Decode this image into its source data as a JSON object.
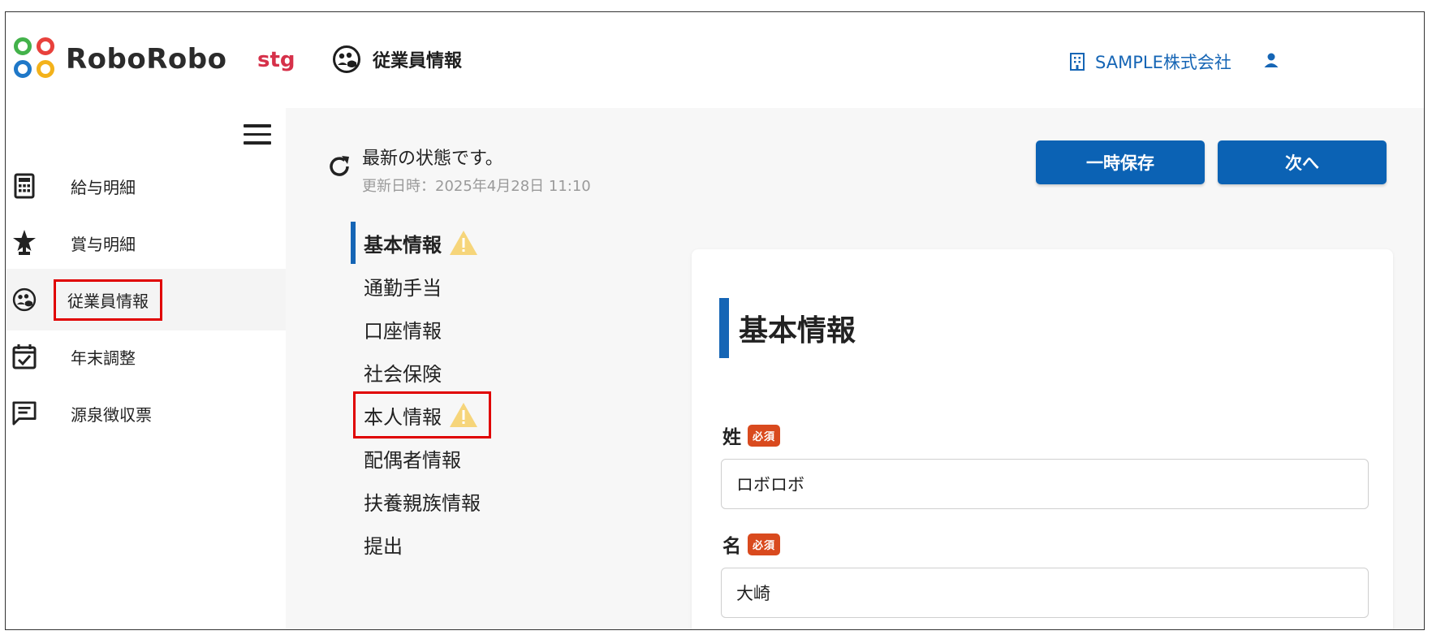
{
  "header": {
    "logo_text": "RoboRobo",
    "env_badge": "stg",
    "page_title": "従業員情報",
    "company": "SAMPLE株式会社",
    "icons": {
      "page": "employee-face-icon",
      "company": "building-icon",
      "user": "user-icon"
    }
  },
  "sidebar": {
    "menu_icon": "hamburger-menu-icon",
    "items": [
      {
        "label": "給与明細",
        "icon": "calculator-icon",
        "active": false
      },
      {
        "label": "賞与明細",
        "icon": "trophy-star-icon",
        "active": false
      },
      {
        "label": "従業員情報",
        "icon": "employee-face-icon",
        "active": true
      },
      {
        "label": "年末調整",
        "icon": "calendar-check-icon",
        "active": false
      },
      {
        "label": "源泉徴収票",
        "icon": "message-icon",
        "active": false
      }
    ]
  },
  "status": {
    "message": "最新の状態です。",
    "updated": "更新日時：2025年4月28日 11:10",
    "icon": "refresh-icon"
  },
  "toolbar": {
    "save_label": "一時保存",
    "next_label": "次へ"
  },
  "section_nav": [
    {
      "label": "基本情報",
      "warning": true,
      "current": true
    },
    {
      "label": "通勤手当",
      "warning": false
    },
    {
      "label": "口座情報",
      "warning": false
    },
    {
      "label": "社会保険",
      "warning": false
    },
    {
      "label": "本人情報",
      "warning": true
    },
    {
      "label": "配偶者情報",
      "warning": false
    },
    {
      "label": "扶養親族情報",
      "warning": false
    },
    {
      "label": "提出",
      "warning": false
    }
  ],
  "form": {
    "title": "基本情報",
    "required_badge": "必須",
    "fields": [
      {
        "label": "姓",
        "value": "ロボロボ",
        "required": true
      },
      {
        "label": "名",
        "value": "大崎",
        "required": true
      }
    ]
  },
  "colors": {
    "primary": "#0b62b4",
    "accent_blue": "#1565b5",
    "required_badge": "#d94a1e",
    "warning": "#f6d57a",
    "stg_badge": "#d6314a",
    "highlight_box": "#e00000"
  }
}
